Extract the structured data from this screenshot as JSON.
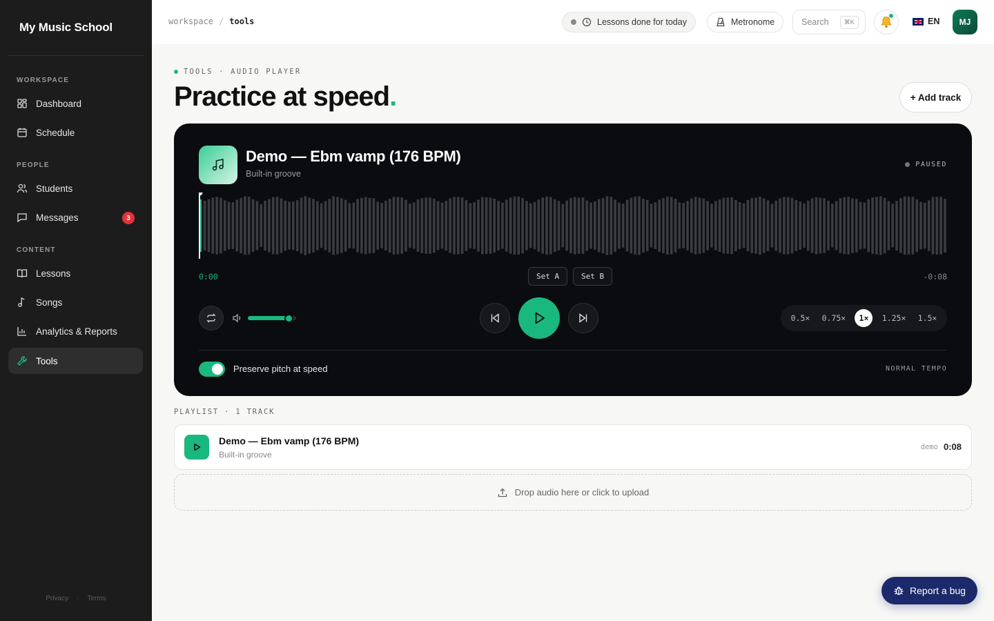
{
  "sidebar": {
    "brand": "My Music School",
    "sections": {
      "workspace": "WORKSPACE",
      "people": "PEOPLE",
      "content": "CONTENT"
    },
    "items": {
      "dashboard": "Dashboard",
      "schedule": "Schedule",
      "students": "Students",
      "messages": "Messages",
      "lessons": "Lessons",
      "songs": "Songs",
      "analytics": "Analytics & Reports",
      "tools": "Tools"
    },
    "messages_badge": "3",
    "footer": {
      "privacy": "Privacy",
      "separator": "·",
      "terms": "Terms"
    }
  },
  "topbar": {
    "breadcrumb": {
      "root": "workspace",
      "separator": "/",
      "current": "tools"
    },
    "lessons_pill": "Lessons done for today",
    "metronome": "Metronome",
    "search_label": "Search",
    "search_shortcut": "⌘K",
    "language": "EN",
    "avatar_initials": "MJ"
  },
  "header": {
    "eyebrow": "TOOLS · AUDIO PLAYER",
    "title": "Practice at speed",
    "title_accent": ".",
    "add_track": "+ Add track"
  },
  "player": {
    "track_title": "Demo — Ebm vamp (176 BPM)",
    "track_subtitle": "Built-in groove",
    "status": "PAUSED",
    "time_elapsed": "0:00",
    "time_remaining": "-0:08",
    "set_a": "Set A",
    "set_b": "Set B",
    "volume_fraction": 0.85,
    "progress_fraction": 0.0,
    "speeds": [
      "0.5×",
      "0.75×",
      "1×",
      "1.25×",
      "1.5×"
    ],
    "active_speed": "1×",
    "preserve_pitch_label": "Preserve pitch at speed",
    "preserve_pitch_on": true,
    "tempo_label": "NORMAL TEMPO"
  },
  "playlist": {
    "header": "PLAYLIST · 1 TRACK",
    "tracks": [
      {
        "title": "Demo — Ebm vamp (176 BPM)",
        "subtitle": "Built-in groove",
        "tag": "demo",
        "duration": "0:08"
      }
    ],
    "dropzone": "Drop audio here or click to upload"
  },
  "report_bug": "Report a bug",
  "colors": {
    "accent": "#19b87f",
    "sidebar_bg": "#1c1c1c",
    "player_bg": "#0b0c10",
    "bug_button": "#1c2a6b",
    "badge": "#e5323a"
  }
}
